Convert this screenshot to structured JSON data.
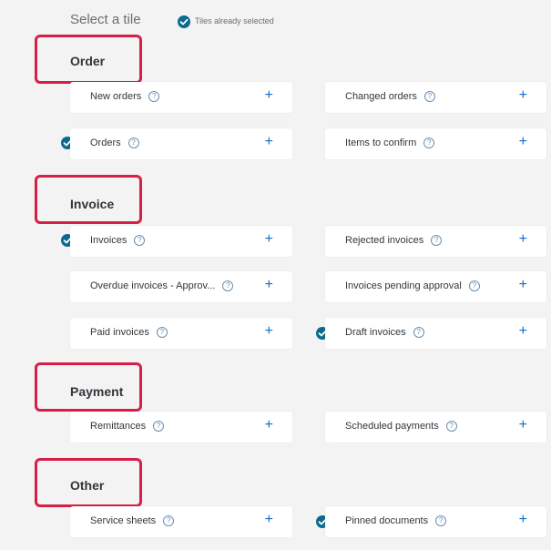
{
  "header": {
    "title": "Select a tile",
    "legend": "Tiles already selected"
  },
  "groups": [
    {
      "title": "Order",
      "tiles": [
        {
          "label": "New orders",
          "selected": false,
          "action": "+",
          "help": "?"
        },
        {
          "label": "Changed orders",
          "selected": false,
          "action": "+",
          "help": "?"
        },
        {
          "label": "Orders",
          "selected": true,
          "action": "+",
          "help": "?"
        },
        {
          "label": "Items to confirm",
          "selected": false,
          "action": "+",
          "help": "?"
        }
      ]
    },
    {
      "title": "Invoice",
      "tiles": [
        {
          "label": "Invoices",
          "selected": true,
          "action": "+",
          "help": "?"
        },
        {
          "label": "Rejected invoices",
          "selected": false,
          "action": "+",
          "help": "?"
        },
        {
          "label": "Overdue invoices - Approv...",
          "selected": false,
          "action": "+",
          "help": "?"
        },
        {
          "label": "Invoices pending approval",
          "selected": false,
          "action": "+",
          "help": "?"
        },
        {
          "label": "Paid invoices",
          "selected": false,
          "action": "+",
          "help": "?"
        },
        {
          "label": "Draft invoices",
          "selected": true,
          "action": "+",
          "help": "?"
        }
      ]
    },
    {
      "title": "Payment",
      "tiles": [
        {
          "label": "Remittances",
          "selected": false,
          "action": "+",
          "help": "?"
        },
        {
          "label": "Scheduled payments",
          "selected": false,
          "action": "+",
          "help": "?"
        }
      ]
    },
    {
      "title": "Other",
      "tiles": [
        {
          "label": "Service sheets",
          "selected": false,
          "action": "+",
          "help": "?"
        },
        {
          "label": "Pinned documents",
          "selected": true,
          "action": "+",
          "help": "?"
        }
      ]
    }
  ],
  "colors": {
    "accent": "#0a6ed1",
    "check": "#0b6a8e",
    "highlight": "#d61f47",
    "background": "#f3f3f3"
  }
}
